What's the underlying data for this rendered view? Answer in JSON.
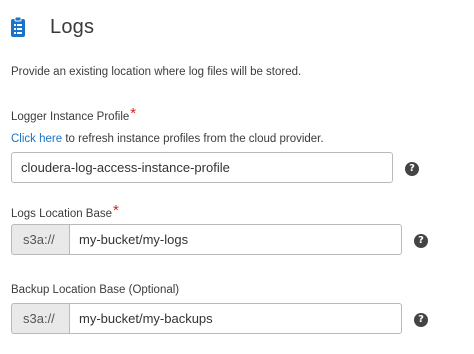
{
  "header": {
    "title": "Logs",
    "icon": "clipboard-icon",
    "icon_color": "#1a73c9"
  },
  "intro": "Provide an existing location where log files will be stored.",
  "logger_instance_profile": {
    "label": "Logger Instance Profile",
    "required_mark": "*",
    "refresh_link": "Click here",
    "refresh_text": " to refresh instance profiles from the cloud provider.",
    "value": "cloudera-log-access-instance-profile",
    "help": "?"
  },
  "logs_location_base": {
    "label": "Logs Location Base",
    "required_mark": "*",
    "prefix": "s3a://",
    "value": "my-bucket/my-logs",
    "help": "?"
  },
  "backup_location_base": {
    "label": "Backup Location Base (Optional)",
    "prefix": "s3a://",
    "value": "my-bucket/my-backups",
    "help": "?"
  },
  "colors": {
    "link": "#1a73c9",
    "required": "#e0201b"
  }
}
